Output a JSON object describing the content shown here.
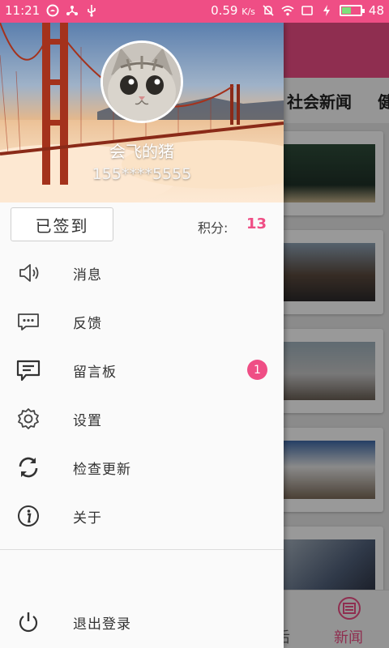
{
  "status_bar": {
    "time": "11:21",
    "speed": "0.59",
    "speed_unit": "K/s",
    "battery": "48",
    "battery_level": 0.48,
    "icons": [
      "app-badge-icon",
      "share-icon",
      "usb-icon",
      "mute-icon",
      "wifi-icon",
      "sim-icon",
      "charging-icon",
      "battery-icon"
    ]
  },
  "background_app": {
    "tabs": [
      "社会新闻",
      "健"
    ],
    "bottom_nav": [
      "后",
      "新闻"
    ]
  },
  "drawer": {
    "username": "会飞的猪",
    "phone": "155****5555",
    "checkin_label": "已签到",
    "points_label": "积分:",
    "points_value": "13",
    "menu": [
      {
        "icon": "speaker-icon",
        "label": "消息"
      },
      {
        "icon": "feedback-icon",
        "label": "反馈"
      },
      {
        "icon": "message-board-icon",
        "label": "留言板",
        "badge": "1"
      },
      {
        "icon": "gear-icon",
        "label": "设置"
      },
      {
        "icon": "refresh-icon",
        "label": "检查更新"
      },
      {
        "icon": "info-icon",
        "label": "关于"
      }
    ],
    "logout_label": "退出登录"
  },
  "colors": {
    "accent": "#ef4e85",
    "drawer_bg": "#fafafa"
  }
}
